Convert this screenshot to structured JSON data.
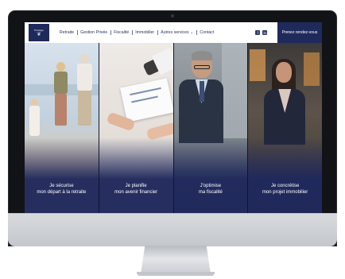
{
  "brand": {
    "name": "Prestige",
    "accent": "#1f2a5c"
  },
  "nav": {
    "items": [
      "Retraite",
      "Gestion Privée",
      "Fiscalité",
      "Immobilier",
      "Autres services ⌄",
      "Contact"
    ]
  },
  "social": {
    "icons": [
      "facebook-icon",
      "linkedin-icon"
    ],
    "facebook": "f",
    "linkedin": "in"
  },
  "cta": {
    "label": "Prenez rendez-vous"
  },
  "hero": {
    "panels": [
      {
        "line1": "Je sécurise",
        "line2": "mon départ à la retraite"
      },
      {
        "line1": "Je planifie",
        "line2": "mon avenir financier"
      },
      {
        "line1": "J'optimise",
        "line2": "ma fiscalité"
      },
      {
        "line1": "Je concrétise",
        "line2": "mon projet immobilier"
      }
    ]
  }
}
